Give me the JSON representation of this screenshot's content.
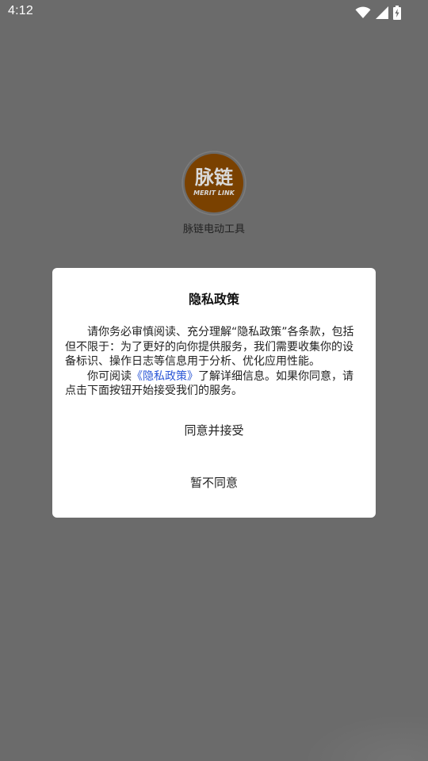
{
  "status_bar": {
    "time": "4:12",
    "icons": [
      "wifi-icon",
      "cell-signal-icon",
      "battery-charging-icon"
    ]
  },
  "app": {
    "logo_text": "脉链",
    "logo_subtext": "MERIT LINK",
    "name": "脉链电动工具"
  },
  "dialog": {
    "title": "隐私政策",
    "paragraph1": "请你务必审慎阅读、充分理解“隐私政策”各条款，包括但不限于：为了更好的向你提供服务，我们需要收集你的设备标识、操作日志等信息用于分析、优化应用性能。",
    "paragraph2_prefix": "你可阅读",
    "paragraph2_link": "《隐私政策》",
    "paragraph2_suffix": "了解详细信息。如果你同意，请点击下面按钮开始接受我们的服务。",
    "agree_label": "同意并接受",
    "disagree_label": "暂不同意"
  },
  "colors": {
    "scrim": "#6b6b6b",
    "dialog_bg": "#ffffff",
    "link": "#2b57d6",
    "logo_fill": "#7a4100"
  }
}
